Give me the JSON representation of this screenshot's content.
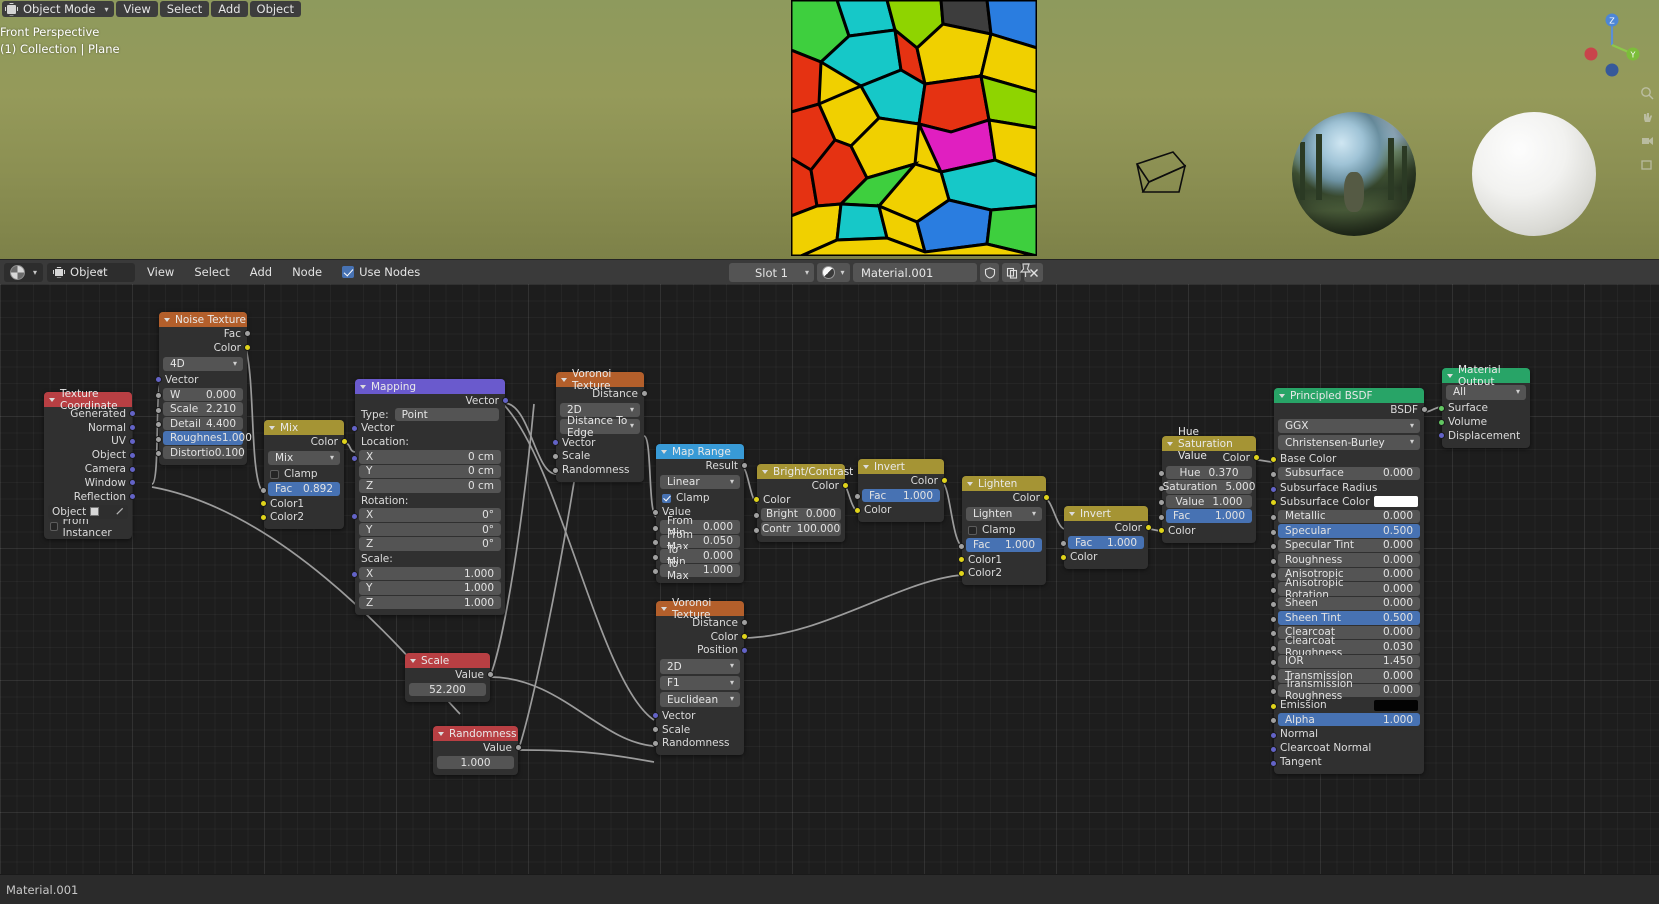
{
  "viewport": {
    "mode_label": "Object Mode",
    "menus": [
      "View",
      "Select",
      "Add",
      "Object"
    ],
    "overlay_line1": "Front Perspective",
    "overlay_line2": "(1) Collection | Plane",
    "gizmo_axes": [
      "X",
      "Y",
      "Z"
    ]
  },
  "node_header": {
    "editor_icon": "shader-editor-icon",
    "shader_type": "Object",
    "menus": [
      "View",
      "Select",
      "Add",
      "Node"
    ],
    "use_nodes_label": "Use Nodes",
    "use_nodes_checked": true,
    "slot": "Slot 1",
    "material_name": "Material.001",
    "browse_icon": "material-browse-icon",
    "fake_user_icon": "shield-icon",
    "new_material_icon": "copy-icon",
    "unlink_icon": "x-icon",
    "pin_icon": "pin-icon"
  },
  "status": {
    "text": "Material.001"
  },
  "nodes": {
    "texture_coordinate": {
      "title": "Texture Coordinate",
      "outputs": [
        "Generated",
        "Normal",
        "UV",
        "Object",
        "Camera",
        "Window",
        "Reflection"
      ],
      "object_label": "Object",
      "from_instancer_label": "From Instancer"
    },
    "noise_texture": {
      "title": "Noise Texture",
      "outputs": [
        "Fac",
        "Color"
      ],
      "dimension": "4D",
      "vector_label": "Vector",
      "props": [
        {
          "name": "W",
          "value": "0.000"
        },
        {
          "name": "Scale",
          "value": "2.210"
        },
        {
          "name": "Detail",
          "value": "4.400"
        },
        {
          "name": "Roughnes",
          "value": "1.000",
          "highlight": true
        },
        {
          "name": "Distortio",
          "value": "0.100"
        }
      ]
    },
    "mix": {
      "title": "Mix",
      "output": "Color",
      "blend_mode": "Mix",
      "clamp_label": "Clamp",
      "clamp_checked": false,
      "fac_name": "Fac",
      "fac_value": "0.892",
      "inputs": [
        "Color1",
        "Color2"
      ]
    },
    "mapping": {
      "title": "Mapping",
      "output": "Vector",
      "type_label": "Type:",
      "type_value": "Point",
      "vector_label": "Vector",
      "location_label": "Location:",
      "location": [
        {
          "axis": "X",
          "value": "0 cm"
        },
        {
          "axis": "Y",
          "value": "0 cm"
        },
        {
          "axis": "Z",
          "value": "0 cm"
        }
      ],
      "rotation_label": "Rotation:",
      "rotation": [
        {
          "axis": "X",
          "value": "0°"
        },
        {
          "axis": "Y",
          "value": "0°"
        },
        {
          "axis": "Z",
          "value": "0°"
        }
      ],
      "scale_label": "Scale:",
      "scale": [
        {
          "axis": "X",
          "value": "1.000"
        },
        {
          "axis": "Y",
          "value": "1.000"
        },
        {
          "axis": "Z",
          "value": "1.000"
        }
      ]
    },
    "voronoi_top": {
      "title": "Voronoi Texture",
      "output": "Distance",
      "dimension": "2D",
      "feature": "Distance To Edge",
      "inputs": [
        "Vector",
        "Scale",
        "Randomness"
      ]
    },
    "map_range": {
      "title": "Map Range",
      "output": "Result",
      "interpolation": "Linear",
      "clamp_label": "Clamp",
      "clamp_checked": true,
      "value_label": "Value",
      "props": [
        {
          "name": "From Min",
          "value": "0.000"
        },
        {
          "name": "From Max",
          "value": "0.050"
        },
        {
          "name": "To Min",
          "value": "0.000"
        },
        {
          "name": "To Max",
          "value": "1.000"
        }
      ]
    },
    "bright_contrast": {
      "title": "Bright/Contrast",
      "output": "Color",
      "color_input": "Color",
      "props": [
        {
          "name": "Bright",
          "value": "0.000"
        },
        {
          "name": "Contr",
          "value": "100.000"
        }
      ]
    },
    "invert_top": {
      "title": "Invert",
      "output": "Color",
      "fac_name": "Fac",
      "fac_value": "1.000",
      "color_input": "Color"
    },
    "lighten": {
      "title": "Lighten",
      "output": "Color",
      "blend_mode": "Lighten",
      "clamp_label": "Clamp",
      "clamp_checked": false,
      "fac_name": "Fac",
      "fac_value": "1.000",
      "inputs": [
        "Color1",
        "Color2"
      ]
    },
    "invert_right": {
      "title": "Invert",
      "output": "Color",
      "fac_name": "Fac",
      "fac_value": "1.000",
      "color_input": "Color"
    },
    "hue_saturation_value": {
      "title": "Hue Saturation Value",
      "output": "Color",
      "props": [
        {
          "name": "Hue",
          "value": "0.370"
        },
        {
          "name": "Saturation",
          "value": "5.000"
        },
        {
          "name": "Value",
          "value": "1.000"
        }
      ],
      "fac_name": "Fac",
      "fac_value": "1.000",
      "color_input": "Color"
    },
    "scale_value": {
      "title": "Scale",
      "output": "Value",
      "value": "52.200"
    },
    "randomness_value": {
      "title": "Randomness",
      "output": "Value",
      "value": "1.000"
    },
    "voronoi_bottom": {
      "title": "Voronoi Texture",
      "outputs": [
        "Distance",
        "Color",
        "Position"
      ],
      "dimension": "2D",
      "feature": "F1",
      "metric": "Euclidean",
      "inputs": [
        "Vector",
        "Scale",
        "Randomness"
      ]
    },
    "principled_bsdf": {
      "title": "Principled BSDF",
      "output": "BSDF",
      "distribution": "GGX",
      "subsurface_method": "Christensen-Burley",
      "inputs": [
        {
          "name": "Base Color",
          "value": "",
          "socket": "yellow",
          "style": "plain"
        },
        {
          "name": "Subsurface",
          "value": "0.000",
          "socket": "grey",
          "style": "field"
        },
        {
          "name": "Subsurface Radius",
          "value": "",
          "socket": "purple",
          "style": "plain"
        },
        {
          "name": "Subsurface Color",
          "value": "",
          "socket": "yellow",
          "style": "swatch"
        },
        {
          "name": "Metallic",
          "value": "0.000",
          "socket": "grey",
          "style": "field"
        },
        {
          "name": "Specular",
          "value": "0.500",
          "socket": "grey",
          "style": "blue"
        },
        {
          "name": "Specular Tint",
          "value": "0.000",
          "socket": "grey",
          "style": "field"
        },
        {
          "name": "Roughness",
          "value": "0.000",
          "socket": "grey",
          "style": "field"
        },
        {
          "name": "Anisotropic",
          "value": "0.000",
          "socket": "grey",
          "style": "field"
        },
        {
          "name": "Anisotropic Rotation",
          "value": "0.000",
          "socket": "grey",
          "style": "field"
        },
        {
          "name": "Sheen",
          "value": "0.000",
          "socket": "grey",
          "style": "field"
        },
        {
          "name": "Sheen Tint",
          "value": "0.500",
          "socket": "grey",
          "style": "blue"
        },
        {
          "name": "Clearcoat",
          "value": "0.000",
          "socket": "grey",
          "style": "field"
        },
        {
          "name": "Clearcoat Roughness",
          "value": "0.030",
          "socket": "grey",
          "style": "field"
        },
        {
          "name": "IOR",
          "value": "1.450",
          "socket": "grey",
          "style": "field"
        },
        {
          "name": "Transmission",
          "value": "0.000",
          "socket": "grey",
          "style": "field"
        },
        {
          "name": "Transmission Roughness",
          "value": "0.000",
          "socket": "grey",
          "style": "field"
        },
        {
          "name": "Emission",
          "value": "",
          "socket": "yellow",
          "style": "swatch-black"
        },
        {
          "name": "Alpha",
          "value": "1.000",
          "socket": "grey",
          "style": "blue"
        },
        {
          "name": "Normal",
          "value": "",
          "socket": "purple",
          "style": "plain"
        },
        {
          "name": "Clearcoat Normal",
          "value": "",
          "socket": "purple",
          "style": "plain"
        },
        {
          "name": "Tangent",
          "value": "",
          "socket": "purple",
          "style": "plain"
        }
      ]
    },
    "material_output": {
      "title": "Material Output",
      "target": "All",
      "inputs": [
        "Surface",
        "Volume",
        "Displacement"
      ]
    }
  },
  "colors": {
    "header_orange": "#b35f2b",
    "header_red": "#b83f43",
    "header_yellow": "#a59434",
    "header_purple": "#6a5acd",
    "header_blue": "#389ad6",
    "header_green": "#28a467",
    "accent_blue": "#4772b3",
    "canvas_bg": "#1d1d1d"
  }
}
